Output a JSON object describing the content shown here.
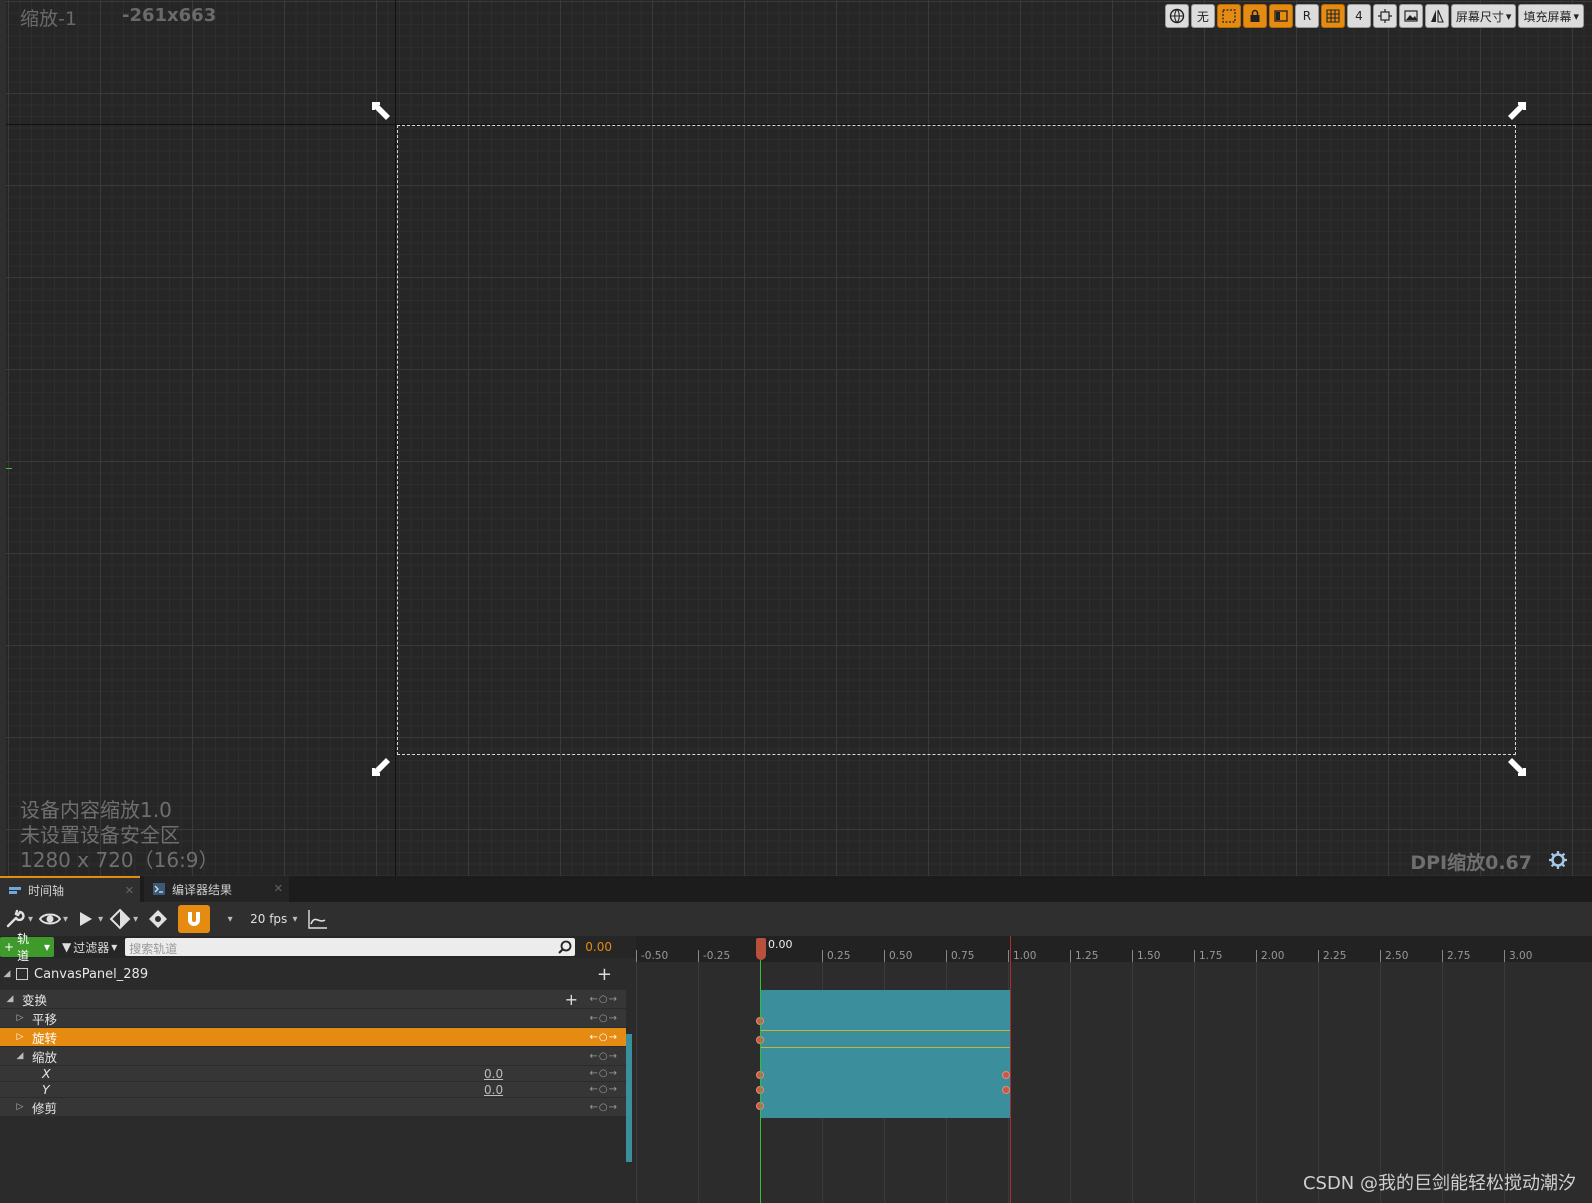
{
  "viewport": {
    "zoom_label": "缩放-1",
    "coord_label": "-261x663",
    "info_lines": [
      "设备内容缩放1.0",
      "未设置设备安全区",
      "1280 x 720（16:9）"
    ],
    "dpi_label": "DPI缩放0.67",
    "toolbar": {
      "none_label": "无",
      "r_label": "R",
      "grid_size": "4",
      "screen_size_label": "屏幕尺寸",
      "fill_screen_label": "填充屏幕"
    }
  },
  "tabs": [
    {
      "label": "时间轴",
      "active": true
    },
    {
      "label": "编译器结果",
      "active": false
    }
  ],
  "sequencer": {
    "fps_label": "20 fps",
    "add_track_label": "轨道",
    "filter_label": "过滤器",
    "search_placeholder": "搜索轨道",
    "current_time": "0.00",
    "root_object": "CanvasPanel_289",
    "tracks": [
      {
        "label": "变换",
        "expanded": true,
        "level": 0
      },
      {
        "label": "平移",
        "expanded": false,
        "level": 1
      },
      {
        "label": "旋转",
        "expanded": false,
        "level": 1,
        "selected": true
      },
      {
        "label": "缩放",
        "expanded": true,
        "level": 1
      },
      {
        "label": "X",
        "level": 2,
        "value": "0.0"
      },
      {
        "label": "Y",
        "level": 2,
        "value": "0.0"
      },
      {
        "label": "修剪",
        "expanded": false,
        "level": 1
      }
    ],
    "playhead_label": "0.00",
    "ruler_ticks": [
      "-0.50",
      "-0.25",
      "0.25",
      "0.50",
      "0.75",
      "1.00",
      "1.25",
      "1.50",
      "1.75",
      "2.00",
      "2.25",
      "2.50",
      "2.75",
      "3.00"
    ]
  },
  "watermark": "CSDN @我的巨剑能轻松搅动潮汐"
}
